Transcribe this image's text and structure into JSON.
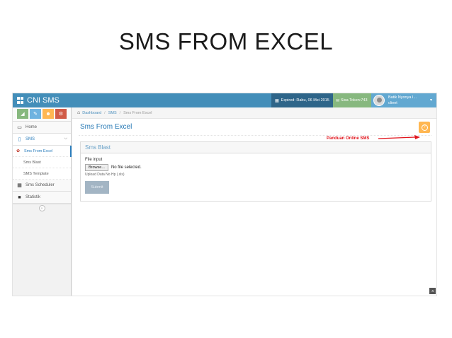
{
  "slide": {
    "title": "SMS FROM EXCEL"
  },
  "navbar": {
    "brand": "CNI SMS",
    "expired": "Expired: Rabu, 06 Mei 2015",
    "token": "Sisa Token:743",
    "user_name": "Batik Nyonya I...",
    "user_role": "client",
    "caret": "▾"
  },
  "sidebar": {
    "shortcuts": [
      {
        "icon": "signal-icon",
        "glyph": "◢",
        "color": "#87b87f"
      },
      {
        "icon": "pencil-icon",
        "glyph": "✎",
        "color": "#6fb3e0"
      },
      {
        "icon": "users-icon",
        "glyph": "☻",
        "color": "#ffb752"
      },
      {
        "icon": "cogs-icon",
        "glyph": "⚙",
        "color": "#d15b47"
      }
    ],
    "items": [
      {
        "label": "Home",
        "icon": "desktop-icon",
        "glyph": "▭"
      },
      {
        "label": "SMS",
        "icon": "tablet-icon",
        "glyph": "▯"
      },
      {
        "label": "Sms Scheduler",
        "icon": "calendar-icon",
        "glyph": "▦"
      },
      {
        "label": "Statistik",
        "icon": "folder-icon",
        "glyph": "■"
      }
    ],
    "sub_items": [
      {
        "label": "Sms From Excel"
      },
      {
        "label": "Sms Blast"
      },
      {
        "label": "SMS Template"
      }
    ],
    "collapse_glyph": "«"
  },
  "breadcrumbs": {
    "home": "Dashboard",
    "section": "SMS",
    "current": "Sms From Excel",
    "separator": "/"
  },
  "page": {
    "title": "Sms From Excel",
    "help_glyph": "?"
  },
  "annotation": {
    "label": "Panduan Online SMS",
    "color": "#e1141c"
  },
  "widget": {
    "title": "Sms Blast",
    "field_label": "File input",
    "browse_label": "Browse...",
    "file_status": "No file selected.",
    "help_text": "Upload Data No Hp (.xls)",
    "submit_label": "Submit"
  },
  "scroll_up_glyph": "«"
}
